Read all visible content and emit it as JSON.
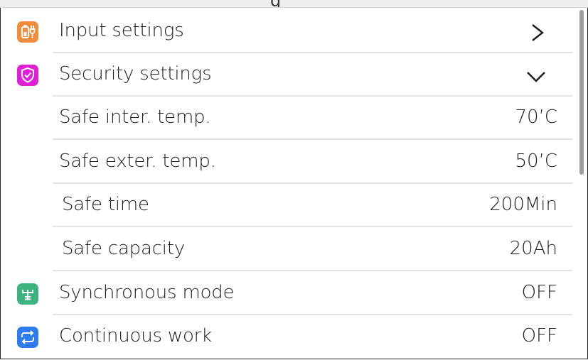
{
  "header": {
    "title": "g"
  },
  "rows": [
    {
      "label": "Input settings",
      "icon": "plug-icon",
      "icon_color": "#F08C3C",
      "control": "chevron-right"
    },
    {
      "label": "Security settings",
      "icon": "shield-icon",
      "icon_color": "#E020D6",
      "control": "chevron-down"
    },
    {
      "label": "Safe inter. temp.",
      "value": "70’C"
    },
    {
      "label": "Safe exter. temp.",
      "value": "50’C"
    },
    {
      "label": "Safe time",
      "value": "200Min"
    },
    {
      "label": "Safe capacity",
      "value": "20Ah"
    },
    {
      "label": "Synchronous mode",
      "value": "OFF",
      "icon": "sync-mode-icon",
      "icon_color": "#3DB37F"
    },
    {
      "label": "Continuous work",
      "value": "OFF",
      "icon": "loop-icon",
      "icon_color": "#2F7CF0"
    }
  ],
  "colors": {
    "divider": "#E2E2E2",
    "scrollbar": "#9E9E9E"
  }
}
